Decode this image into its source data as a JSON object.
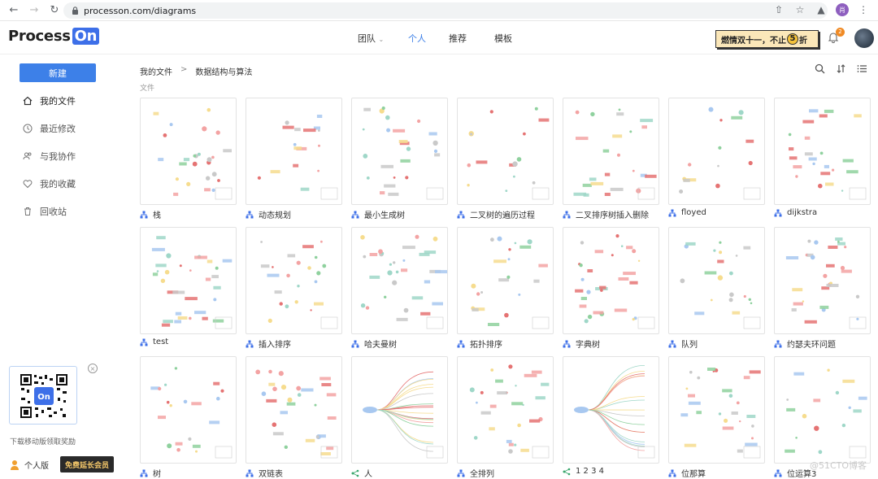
{
  "browser": {
    "url": "processon.com/diagrams",
    "profile_initial": "肖"
  },
  "header": {
    "logo_text": "Process",
    "logo_on": "On",
    "nav": [
      {
        "label": "团队",
        "has_dropdown": true
      },
      {
        "label": "个人",
        "active": true
      },
      {
        "label": "推荐"
      },
      {
        "label": "模板"
      }
    ],
    "promo_text": "燃情双十一，不止",
    "promo_num": "5",
    "promo_suffix": "折",
    "notification_count": "2"
  },
  "sidebar": {
    "new_button": "新建",
    "items": [
      {
        "label": "我的文件",
        "icon": "home-icon",
        "active": true
      },
      {
        "label": "最近修改",
        "icon": "clock-icon"
      },
      {
        "label": "与我协作",
        "icon": "users-icon"
      },
      {
        "label": "我的收藏",
        "icon": "heart-icon"
      },
      {
        "label": "回收站",
        "icon": "trash-icon"
      }
    ],
    "qr_caption": "下载移动版领取奖励",
    "qr_logo": "On",
    "account_type": "个人版",
    "upgrade_button": "免费延长会员"
  },
  "main": {
    "breadcrumb": [
      "我的文件",
      "数据结构与算法"
    ],
    "breadcrumb_sep": ">",
    "section_label": "文件",
    "files": [
      {
        "name": "栈",
        "type": "flowchart"
      },
      {
        "name": "动态规划",
        "type": "flowchart"
      },
      {
        "name": "最小生成树",
        "type": "flowchart"
      },
      {
        "name": "二叉树的遍历过程",
        "type": "flowchart"
      },
      {
        "name": "二叉排序树插入删除",
        "type": "flowchart"
      },
      {
        "name": "floyed",
        "type": "flowchart"
      },
      {
        "name": "dijkstra",
        "type": "flowchart"
      },
      {
        "name": "test",
        "type": "flowchart"
      },
      {
        "name": "插入排序",
        "type": "flowchart"
      },
      {
        "name": "哈夫曼树",
        "type": "flowchart"
      },
      {
        "name": "拓扑排序",
        "type": "flowchart"
      },
      {
        "name": "字典树",
        "type": "flowchart"
      },
      {
        "name": "队列",
        "type": "flowchart"
      },
      {
        "name": "约瑟夫环问题",
        "type": "flowchart"
      },
      {
        "name": "树",
        "type": "flowchart"
      },
      {
        "name": "双链表",
        "type": "flowchart"
      },
      {
        "name": "人",
        "type": "mindmap"
      },
      {
        "name": "全排列",
        "type": "flowchart"
      },
      {
        "name": "1 2 3 4",
        "type": "mindmap"
      },
      {
        "name": "位那算",
        "type": "flowchart"
      },
      {
        "name": "位运算3",
        "type": "flowchart"
      }
    ]
  },
  "watermark": "@51CTO博客",
  "colors": {
    "accent": "#3d80e8",
    "flowchart_icon": "#3d6fe8",
    "mindmap_icon": "#3aa76d",
    "promo_bg": "#fbe7b9"
  }
}
